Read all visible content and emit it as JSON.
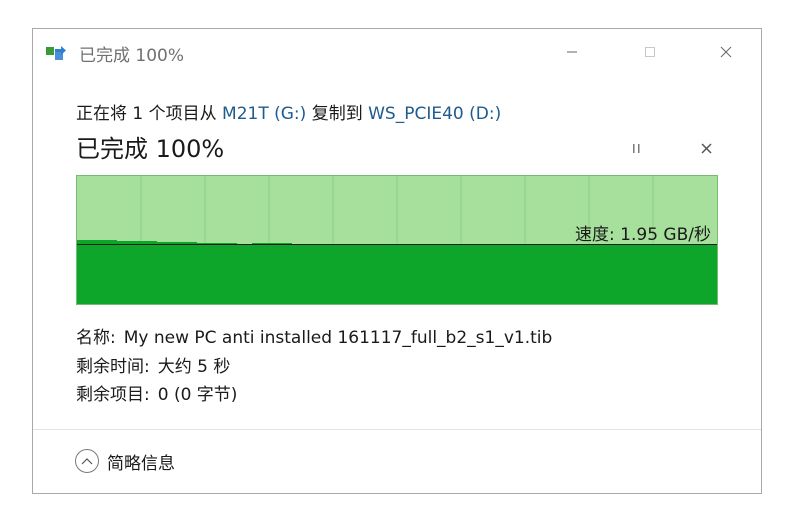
{
  "window": {
    "title": "已完成 100%",
    "minimize_glyph": "—",
    "maximize_glyph": "☐",
    "close_glyph": "✕"
  },
  "copy": {
    "prefix": "正在将 1 个项目从 ",
    "source": "M21T (G:)",
    "middle": " 复制到 ",
    "destination": "WS_PCIE40 (D:)"
  },
  "status": {
    "headline": "已完成 100%",
    "progress_percent": 100
  },
  "graph": {
    "speed_text": "速度: 1.95 GB/秒",
    "fill_color": "#0ea52b",
    "background_color": "#a6e09c",
    "complete_fraction": 1.0
  },
  "details": {
    "name_label": "名称:",
    "name_value": "My new PC anti installed 161117_full_b2_s1_v1.tib",
    "time_label": "剩余时间:",
    "time_value": "大约 5 秒",
    "items_label": "剩余项目:",
    "items_value": "0 (0 字节)"
  },
  "footer": {
    "toggle_label": "简略信息"
  },
  "icons": {
    "title_icon": "copy-transfer-icon",
    "pause_icon": "pause-icon",
    "cancel_icon": "close-icon",
    "collapse_icon": "chevron-up-icon"
  }
}
